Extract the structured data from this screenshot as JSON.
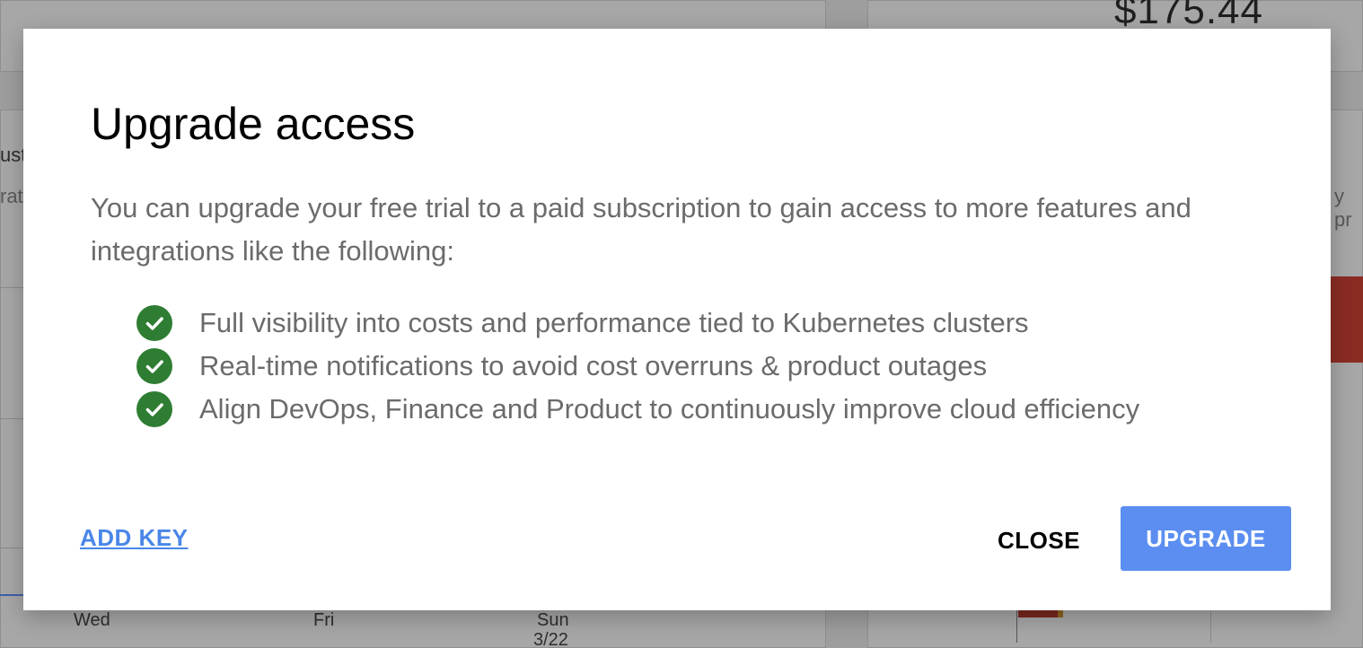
{
  "background": {
    "amount": "$175.44",
    "left_fragment_1": "ust",
    "left_fragment_2": "rat",
    "right_fragment": "y pr",
    "ticks": [
      "Wed",
      "Fri",
      "Sun"
    ],
    "tick_date": "3/22"
  },
  "dialog": {
    "title": "Upgrade access",
    "description": "You can upgrade your free trial to a paid subscription to gain access to more features and integrations like the following:",
    "features": [
      "Full visibility into costs and performance tied to Kubernetes clusters",
      "Real-time notifications to avoid cost overruns & product outages",
      "Align DevOps, Finance and Product to continuously improve cloud efficiency"
    ],
    "add_key_label": "ADD KEY",
    "close_label": "CLOSE",
    "upgrade_label": "UPGRADE"
  },
  "colors": {
    "check_green": "#2e7d32",
    "link_blue": "#4a86e8",
    "upgrade_blue": "#5b8ef0",
    "overlay_gray": "#9e9e9e"
  },
  "icons": {
    "feature_icon": "check-circle-icon"
  }
}
